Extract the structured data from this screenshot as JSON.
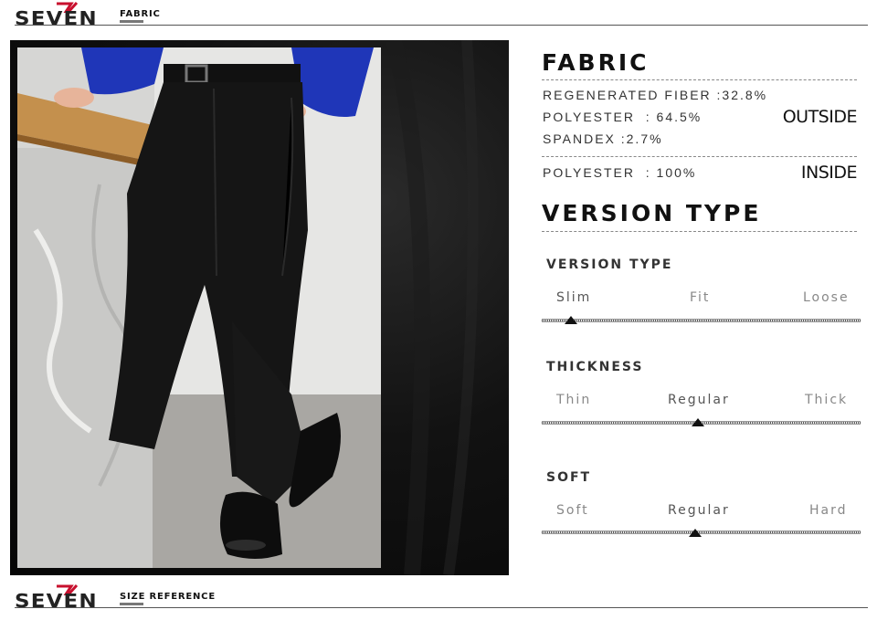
{
  "brand": {
    "logo_text": "SEVEN",
    "accent_color": "#c8102e"
  },
  "top_header": {
    "label": "FABRIC"
  },
  "bottom_header": {
    "label": "SIZE REFERENCE"
  },
  "fabric": {
    "title": "FABRIC",
    "outside_lines": [
      "REGENERATED FIBER :32.8%",
      "POLYESTER  : 64.5%",
      "SPANDEX :2.7%"
    ],
    "outside_tag": "OUTSIDE",
    "inside_line": "POLYESTER  : 100%",
    "inside_tag": "INSIDE"
  },
  "version_section": {
    "title": "VERSION TYPE"
  },
  "scales": [
    {
      "title": "VERSION TYPE",
      "options": [
        "Slim",
        "Fit",
        "Loose"
      ],
      "selected": "Slim",
      "selected_index": 0
    },
    {
      "title": "THICKNESS",
      "options": [
        "Thin",
        "Regular",
        "Thick"
      ],
      "selected": "Regular",
      "selected_index": 1
    },
    {
      "title": "SOFT",
      "options": [
        "Soft",
        "Regular",
        "Hard"
      ],
      "selected": "Regular",
      "selected_index": 1
    }
  ],
  "photo": {
    "subject": "model-wearing-black-trousers",
    "icon": "trousers-photo"
  }
}
